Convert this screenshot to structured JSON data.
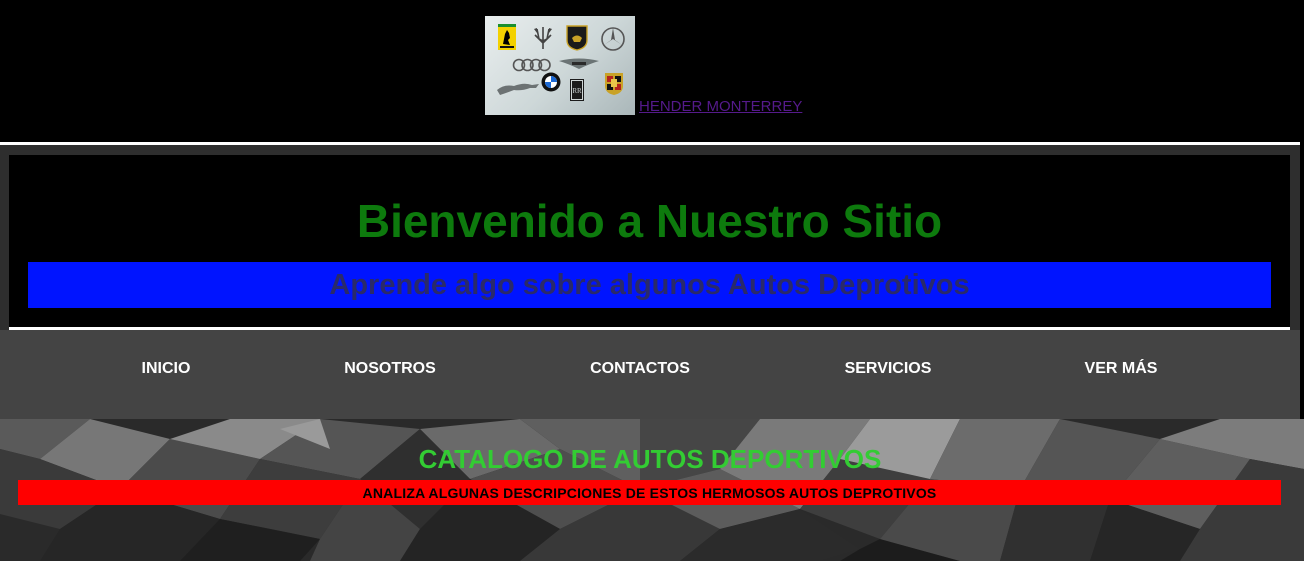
{
  "top": {
    "logo_icon": "car-brands-logo-collage",
    "brands": [
      "ferrari",
      "maserati",
      "lamborghini",
      "mercedes",
      "audi",
      "aston-martin",
      "bmw",
      "jaguar",
      "rolls-royce",
      "porsche"
    ],
    "link_text": " HENDER MONTERREY",
    "link_color": "#551a8b"
  },
  "header": {
    "title": "Bienvenido a Nuestro Sitio",
    "title_color": "#0d7a0d",
    "subtitle": "Aprende algo sobre algunos Autos Deprotivos",
    "subtitle_bar_color": "#0014ff"
  },
  "nav": {
    "items": [
      {
        "label": "INICIO"
      },
      {
        "label": "NOSOTROS"
      },
      {
        "label": "CONTACTOS"
      },
      {
        "label": "SERVICIOS"
      },
      {
        "label": "VER MÁS"
      }
    ],
    "background": "#444444"
  },
  "catalog": {
    "title": "CATALOGO DE AUTOS DEPORTIVOS",
    "title_color": "#33cc33",
    "subtitle": "ANALIZA ALGUNAS DESCRIPCIONES DE ESTOS HERMOSOS AUTOS DEPROTIVOS",
    "subtitle_bar_color": "#ff0000",
    "background_icon": "dark-3d-cubes-background"
  }
}
